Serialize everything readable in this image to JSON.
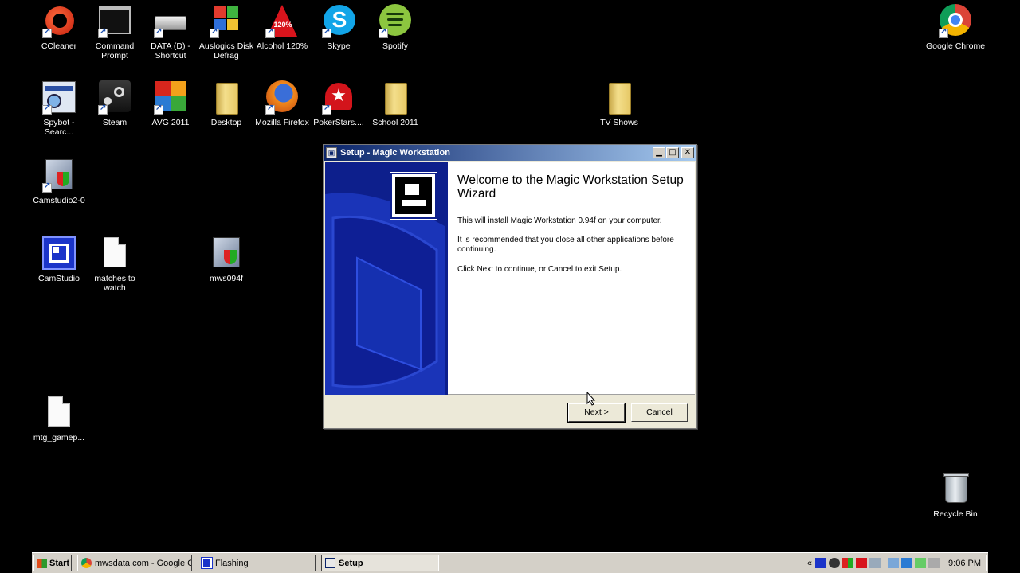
{
  "desktop": {
    "icons": [
      {
        "label": "CCleaner",
        "icon": "ccleaner-icon"
      },
      {
        "label": "Command Prompt",
        "icon": "command-prompt-icon"
      },
      {
        "label": "DATA (D) - Shortcut",
        "icon": "drive-icon"
      },
      {
        "label": "Auslogics Disk Defrag",
        "icon": "defrag-icon"
      },
      {
        "label": "Alcohol 120%",
        "icon": "alcohol-icon"
      },
      {
        "label": "Skype",
        "icon": "skype-icon"
      },
      {
        "label": "Spotify",
        "icon": "spotify-icon"
      },
      {
        "label": "Google Chrome",
        "icon": "chrome-icon"
      },
      {
        "label": "Spybot - Searc...",
        "icon": "spybot-icon"
      },
      {
        "label": "Steam",
        "icon": "steam-icon"
      },
      {
        "label": "AVG 2011",
        "icon": "avg-icon"
      },
      {
        "label": "Desktop",
        "icon": "folder-icon"
      },
      {
        "label": "Mozilla Firefox",
        "icon": "firefox-icon"
      },
      {
        "label": "PokerStars....",
        "icon": "pokerstars-icon"
      },
      {
        "label": "School 2011",
        "icon": "folder-icon"
      },
      {
        "label": "TV Shows",
        "icon": "folder-icon"
      },
      {
        "label": "Camstudio2-0",
        "icon": "installer-icon"
      },
      {
        "label": "CamStudio",
        "icon": "camstudio-icon"
      },
      {
        "label": "matches to watch",
        "icon": "text-file-icon"
      },
      {
        "label": "mws094f",
        "icon": "installer-icon"
      },
      {
        "label": "mtg_gamep...",
        "icon": "file-icon"
      },
      {
        "label": "Recycle Bin",
        "icon": "recycle-bin-icon"
      }
    ]
  },
  "window": {
    "title": "Setup - Magic Workstation",
    "heading": "Welcome to the Magic Workstation Setup Wizard",
    "para1": "This will install Magic Workstation 0.94f on your computer.",
    "para2": "It is recommended that you close all other applications before continuing.",
    "para3": "Click Next to continue, or Cancel to exit Setup.",
    "next_label": "Next >",
    "cancel_label": "Cancel"
  },
  "taskbar": {
    "start_label": "Start",
    "tasks": [
      {
        "label": "mwsdata.com - Google C...",
        "icon": "chrome-icon"
      },
      {
        "label": "Flashing",
        "icon": "camstudio-icon"
      },
      {
        "label": "Setup",
        "icon": "setup-icon"
      }
    ],
    "tray_expand": "«",
    "clock": "9:06 PM"
  },
  "colors": {
    "desktop": "#000000",
    "title_bar_start": "#0a246a",
    "title_bar_end": "#a6caf0",
    "wizard_panel": "#0d1f8c",
    "button_face": "#ece9d8"
  }
}
